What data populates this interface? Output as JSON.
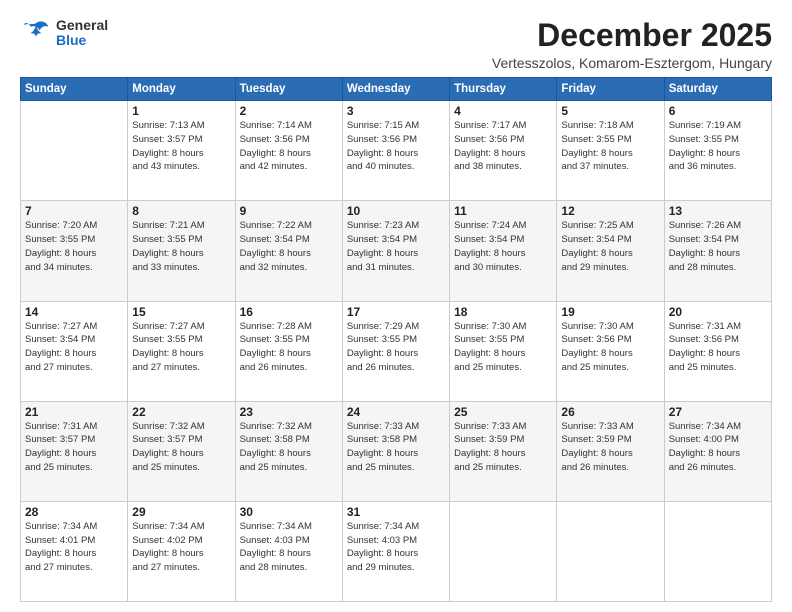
{
  "header": {
    "logo_general": "General",
    "logo_blue": "Blue",
    "month_title": "December 2025",
    "subtitle": "Vertesszolos, Komarom-Esztergom, Hungary"
  },
  "days_of_week": [
    "Sunday",
    "Monday",
    "Tuesday",
    "Wednesday",
    "Thursday",
    "Friday",
    "Saturday"
  ],
  "weeks": [
    [
      {
        "day": "",
        "sunrise": "",
        "sunset": "",
        "daylight": ""
      },
      {
        "day": "1",
        "sunrise": "Sunrise: 7:13 AM",
        "sunset": "Sunset: 3:57 PM",
        "daylight": "Daylight: 8 hours and 43 minutes."
      },
      {
        "day": "2",
        "sunrise": "Sunrise: 7:14 AM",
        "sunset": "Sunset: 3:56 PM",
        "daylight": "Daylight: 8 hours and 42 minutes."
      },
      {
        "day": "3",
        "sunrise": "Sunrise: 7:15 AM",
        "sunset": "Sunset: 3:56 PM",
        "daylight": "Daylight: 8 hours and 40 minutes."
      },
      {
        "day": "4",
        "sunrise": "Sunrise: 7:17 AM",
        "sunset": "Sunset: 3:56 PM",
        "daylight": "Daylight: 8 hours and 38 minutes."
      },
      {
        "day": "5",
        "sunrise": "Sunrise: 7:18 AM",
        "sunset": "Sunset: 3:55 PM",
        "daylight": "Daylight: 8 hours and 37 minutes."
      },
      {
        "day": "6",
        "sunrise": "Sunrise: 7:19 AM",
        "sunset": "Sunset: 3:55 PM",
        "daylight": "Daylight: 8 hours and 36 minutes."
      }
    ],
    [
      {
        "day": "7",
        "sunrise": "Sunrise: 7:20 AM",
        "sunset": "Sunset: 3:55 PM",
        "daylight": "Daylight: 8 hours and 34 minutes."
      },
      {
        "day": "8",
        "sunrise": "Sunrise: 7:21 AM",
        "sunset": "Sunset: 3:55 PM",
        "daylight": "Daylight: 8 hours and 33 minutes."
      },
      {
        "day": "9",
        "sunrise": "Sunrise: 7:22 AM",
        "sunset": "Sunset: 3:54 PM",
        "daylight": "Daylight: 8 hours and 32 minutes."
      },
      {
        "day": "10",
        "sunrise": "Sunrise: 7:23 AM",
        "sunset": "Sunset: 3:54 PM",
        "daylight": "Daylight: 8 hours and 31 minutes."
      },
      {
        "day": "11",
        "sunrise": "Sunrise: 7:24 AM",
        "sunset": "Sunset: 3:54 PM",
        "daylight": "Daylight: 8 hours and 30 minutes."
      },
      {
        "day": "12",
        "sunrise": "Sunrise: 7:25 AM",
        "sunset": "Sunset: 3:54 PM",
        "daylight": "Daylight: 8 hours and 29 minutes."
      },
      {
        "day": "13",
        "sunrise": "Sunrise: 7:26 AM",
        "sunset": "Sunset: 3:54 PM",
        "daylight": "Daylight: 8 hours and 28 minutes."
      }
    ],
    [
      {
        "day": "14",
        "sunrise": "Sunrise: 7:27 AM",
        "sunset": "Sunset: 3:54 PM",
        "daylight": "Daylight: 8 hours and 27 minutes."
      },
      {
        "day": "15",
        "sunrise": "Sunrise: 7:27 AM",
        "sunset": "Sunset: 3:55 PM",
        "daylight": "Daylight: 8 hours and 27 minutes."
      },
      {
        "day": "16",
        "sunrise": "Sunrise: 7:28 AM",
        "sunset": "Sunset: 3:55 PM",
        "daylight": "Daylight: 8 hours and 26 minutes."
      },
      {
        "day": "17",
        "sunrise": "Sunrise: 7:29 AM",
        "sunset": "Sunset: 3:55 PM",
        "daylight": "Daylight: 8 hours and 26 minutes."
      },
      {
        "day": "18",
        "sunrise": "Sunrise: 7:30 AM",
        "sunset": "Sunset: 3:55 PM",
        "daylight": "Daylight: 8 hours and 25 minutes."
      },
      {
        "day": "19",
        "sunrise": "Sunrise: 7:30 AM",
        "sunset": "Sunset: 3:56 PM",
        "daylight": "Daylight: 8 hours and 25 minutes."
      },
      {
        "day": "20",
        "sunrise": "Sunrise: 7:31 AM",
        "sunset": "Sunset: 3:56 PM",
        "daylight": "Daylight: 8 hours and 25 minutes."
      }
    ],
    [
      {
        "day": "21",
        "sunrise": "Sunrise: 7:31 AM",
        "sunset": "Sunset: 3:57 PM",
        "daylight": "Daylight: 8 hours and 25 minutes."
      },
      {
        "day": "22",
        "sunrise": "Sunrise: 7:32 AM",
        "sunset": "Sunset: 3:57 PM",
        "daylight": "Daylight: 8 hours and 25 minutes."
      },
      {
        "day": "23",
        "sunrise": "Sunrise: 7:32 AM",
        "sunset": "Sunset: 3:58 PM",
        "daylight": "Daylight: 8 hours and 25 minutes."
      },
      {
        "day": "24",
        "sunrise": "Sunrise: 7:33 AM",
        "sunset": "Sunset: 3:58 PM",
        "daylight": "Daylight: 8 hours and 25 minutes."
      },
      {
        "day": "25",
        "sunrise": "Sunrise: 7:33 AM",
        "sunset": "Sunset: 3:59 PM",
        "daylight": "Daylight: 8 hours and 25 minutes."
      },
      {
        "day": "26",
        "sunrise": "Sunrise: 7:33 AM",
        "sunset": "Sunset: 3:59 PM",
        "daylight": "Daylight: 8 hours and 26 minutes."
      },
      {
        "day": "27",
        "sunrise": "Sunrise: 7:34 AM",
        "sunset": "Sunset: 4:00 PM",
        "daylight": "Daylight: 8 hours and 26 minutes."
      }
    ],
    [
      {
        "day": "28",
        "sunrise": "Sunrise: 7:34 AM",
        "sunset": "Sunset: 4:01 PM",
        "daylight": "Daylight: 8 hours and 27 minutes."
      },
      {
        "day": "29",
        "sunrise": "Sunrise: 7:34 AM",
        "sunset": "Sunset: 4:02 PM",
        "daylight": "Daylight: 8 hours and 27 minutes."
      },
      {
        "day": "30",
        "sunrise": "Sunrise: 7:34 AM",
        "sunset": "Sunset: 4:03 PM",
        "daylight": "Daylight: 8 hours and 28 minutes."
      },
      {
        "day": "31",
        "sunrise": "Sunrise: 7:34 AM",
        "sunset": "Sunset: 4:03 PM",
        "daylight": "Daylight: 8 hours and 29 minutes."
      },
      {
        "day": "",
        "sunrise": "",
        "sunset": "",
        "daylight": ""
      },
      {
        "day": "",
        "sunrise": "",
        "sunset": "",
        "daylight": ""
      },
      {
        "day": "",
        "sunrise": "",
        "sunset": "",
        "daylight": ""
      }
    ]
  ]
}
